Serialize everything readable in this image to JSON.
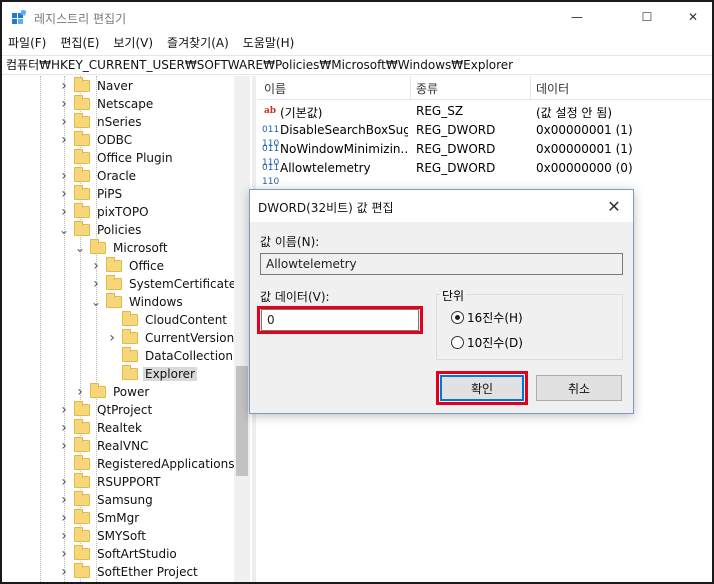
{
  "window": {
    "title": "레지스트리 편집기",
    "minimize_glyph": "—",
    "maximize_glyph": "☐",
    "close_glyph": "✕"
  },
  "menu": [
    "파일(F)",
    "편집(E)",
    "보기(V)",
    "즐겨찾기(A)",
    "도움말(H)"
  ],
  "address": "컴퓨터₩HKEY_CURRENT_USER₩SOFTWARE₩Policies₩Microsoft₩Windows₩Explorer",
  "tree": {
    "items": [
      {
        "label": "Naver",
        "level": 0,
        "expander": "collapsed"
      },
      {
        "label": "Netscape",
        "level": 0,
        "expander": "collapsed"
      },
      {
        "label": "nSeries",
        "level": 0,
        "expander": "collapsed"
      },
      {
        "label": "ODBC",
        "level": 0,
        "expander": "collapsed"
      },
      {
        "label": "Office Plugin",
        "level": 0,
        "expander": "none"
      },
      {
        "label": "Oracle",
        "level": 0,
        "expander": "collapsed"
      },
      {
        "label": "PiPS",
        "level": 0,
        "expander": "collapsed"
      },
      {
        "label": "pixTOPO",
        "level": 0,
        "expander": "collapsed"
      },
      {
        "label": "Policies",
        "level": 0,
        "expander": "expanded"
      },
      {
        "label": "Microsoft",
        "level": 1,
        "expander": "expanded"
      },
      {
        "label": "Office",
        "level": 2,
        "expander": "collapsed"
      },
      {
        "label": "SystemCertificates",
        "level": 2,
        "expander": "collapsed"
      },
      {
        "label": "Windows",
        "level": 2,
        "expander": "expanded"
      },
      {
        "label": "CloudContent",
        "level": 3,
        "expander": "none"
      },
      {
        "label": "CurrentVersion",
        "level": 3,
        "expander": "collapsed"
      },
      {
        "label": "DataCollection",
        "level": 3,
        "expander": "none"
      },
      {
        "label": "Explorer",
        "level": 3,
        "expander": "none",
        "selected": true
      },
      {
        "label": "Power",
        "level": 1,
        "expander": "collapsed"
      },
      {
        "label": "QtProject",
        "level": 0,
        "expander": "collapsed"
      },
      {
        "label": "Realtek",
        "level": 0,
        "expander": "collapsed"
      },
      {
        "label": "RealVNC",
        "level": 0,
        "expander": "collapsed"
      },
      {
        "label": "RegisteredApplications",
        "level": 0,
        "expander": "none"
      },
      {
        "label": "RSUPPORT",
        "level": 0,
        "expander": "collapsed"
      },
      {
        "label": "Samsung",
        "level": 0,
        "expander": "collapsed"
      },
      {
        "label": "SmMgr",
        "level": 0,
        "expander": "collapsed"
      },
      {
        "label": "SMYSoft",
        "level": 0,
        "expander": "collapsed"
      },
      {
        "label": "SoftArtStudio",
        "level": 0,
        "expander": "collapsed"
      },
      {
        "label": "SoftEther Project",
        "level": 0,
        "expander": "collapsed"
      }
    ]
  },
  "list": {
    "headers": [
      "이름",
      "종류",
      "데이터"
    ],
    "rows": [
      {
        "icon": "string-value-icon",
        "name": "(기본값)",
        "type": "REG_SZ",
        "data": "(값 설정 안 됨)"
      },
      {
        "icon": "binary-value-icon",
        "name": "DisableSearchBoxSug...",
        "type": "REG_DWORD",
        "data": "0x00000001 (1)"
      },
      {
        "icon": "binary-value-icon",
        "name": "NoWindowMinimizin...",
        "type": "REG_DWORD",
        "data": "0x00000001 (1)"
      },
      {
        "icon": "binary-value-icon",
        "name": "Allowtelemetry",
        "type": "REG_DWORD",
        "data": "0x00000000 (0)"
      }
    ]
  },
  "dialog": {
    "title": "DWORD(32비트) 값 편집",
    "value_name_label": "값 이름(N):",
    "value_name": "Allowtelemetry",
    "value_data_label": "값 데이터(V):",
    "value_data": "0",
    "base_label": "단위",
    "radio_hex": "16진수(H)",
    "radio_dec": "10진수(D)",
    "ok_label": "확인",
    "cancel_label": "취소",
    "highlight_color": "#e3001b"
  }
}
